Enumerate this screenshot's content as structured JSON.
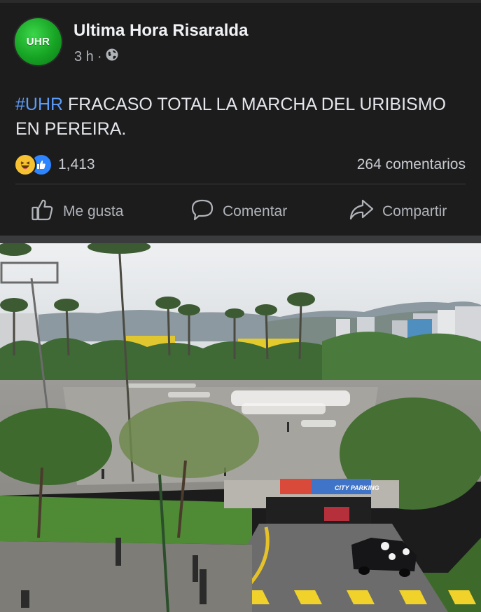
{
  "post": {
    "page_name": "Ultima Hora Risaralda",
    "avatar_text": "UHR",
    "time_ago": "3 h",
    "meta_dot": "·",
    "audience_icon": "globe-icon",
    "hashtag": "#UHR",
    "text": " FRACASO TOTAL LA MARCHA DEL URIBISMO EN PEREIRA.",
    "reaction_icons": [
      "haha-icon",
      "like-icon"
    ],
    "reaction_count": "1,413",
    "comments_count": "264 comentarios"
  },
  "actions": {
    "like_label": "Me gusta",
    "comment_label": "Comentar",
    "share_label": "Compartir"
  },
  "photo": {
    "sign_text": "CITY PARKING"
  },
  "colors": {
    "background": "#1c1c1d",
    "hashtag": "#5b9cf8",
    "avatar_green": "#17a324",
    "like_blue": "#2d86ff",
    "haha_yellow": "#f7c232"
  }
}
